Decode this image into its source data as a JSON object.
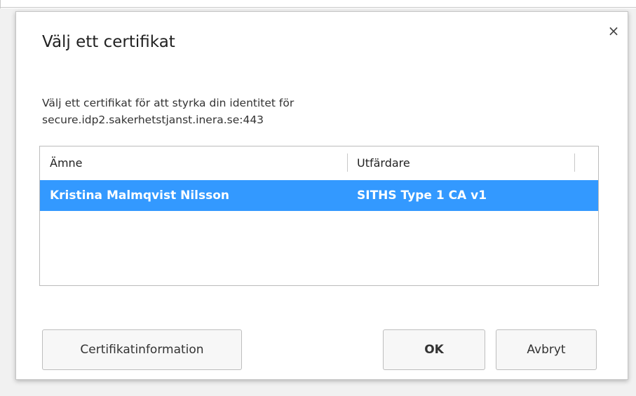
{
  "dialog": {
    "title": "Välj ett certifikat",
    "close_icon": "×",
    "description_line1": "Välj ett certifikat för att styrka din identitet för",
    "description_line2": "secure.idp2.sakerhetstjanst.inera.se:443",
    "columns": {
      "subject": "Ämne",
      "issuer": "Utfärdare"
    },
    "rows": [
      {
        "subject": "Kristina Malmqvist Nilsson",
        "issuer": "SITHS Type 1 CA v1",
        "selected": true
      }
    ],
    "buttons": {
      "certificate_info": "Certifikatinformation",
      "ok": "OK",
      "cancel": "Avbryt"
    },
    "colors": {
      "selection": "#3399ff",
      "selection_text": "#ffffff"
    }
  }
}
